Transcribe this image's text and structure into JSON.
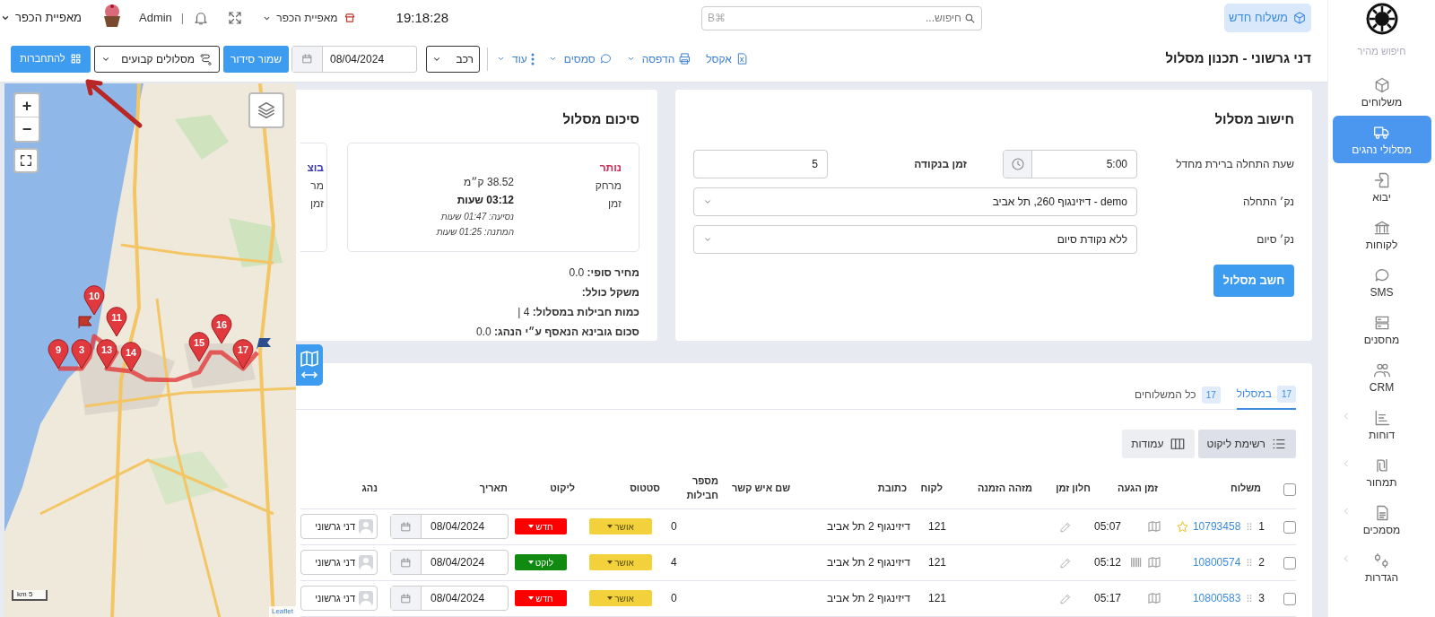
{
  "sidebar": {
    "search_label": "חיפוש מהיר",
    "items": [
      {
        "label": "משלוחים",
        "selected": false,
        "submenu": false
      },
      {
        "label": "מסלולי נהגים",
        "selected": true,
        "submenu": false
      },
      {
        "label": "יבוא",
        "selected": false,
        "submenu": false
      },
      {
        "label": "לקוחות",
        "selected": false,
        "submenu": false
      },
      {
        "label": "SMS",
        "selected": false,
        "submenu": false
      },
      {
        "label": "מחסנים",
        "selected": false,
        "submenu": false
      },
      {
        "label": "CRM",
        "selected": false,
        "submenu": false
      },
      {
        "label": "דוחות",
        "selected": false,
        "submenu": true
      },
      {
        "label": "תמחור",
        "selected": false,
        "submenu": true
      },
      {
        "label": "מסמכים",
        "selected": false,
        "submenu": true
      },
      {
        "label": "הגדרות",
        "selected": false,
        "submenu": true
      }
    ]
  },
  "header": {
    "new_button": "משלוח חדש",
    "search": {
      "placeholder": "חיפוש...",
      "shortcut": "⌘B"
    },
    "clock": "19:18:28",
    "branch": "מאפיית הכפר",
    "separator": "|",
    "user": "Admin",
    "org": "מאפיית הכפר"
  },
  "toolbar": {
    "title": "דני גרשוני - תכנון מסלול",
    "actions": [
      {
        "label": "אקסל",
        "dropdown": false
      },
      {
        "label": "הדפסה",
        "dropdown": true
      },
      {
        "label": "סמסים",
        "dropdown": true
      },
      {
        "label": "עוד",
        "dropdown": true
      }
    ],
    "vehicle": "רכב",
    "date": "08/04/2024",
    "save": "שמור סידור",
    "fixed_routes": "מסלולים קבועים",
    "connect": "להתחברות"
  },
  "route_calc": {
    "title": "חישוב מסלול",
    "start_time_label": "שעת התחלה ברירת מחדל",
    "start_time": "5:00",
    "stop_time_label": "זמן בנקודה",
    "stop_time": "5",
    "start_point_label": "נק׳ התחלה",
    "start_point": "demo - דיזינגוף 260, תל אביב",
    "end_point_label": "נק׳ סיום",
    "end_point": "ללא נקודת סיום",
    "button": "חשב מסלול"
  },
  "route_summary": {
    "title": "סיכום מסלול",
    "remaining": {
      "heading": "נותר",
      "distance_label": "מרחק",
      "distance": "38.52 ק״מ",
      "time_label": "זמן",
      "time": "03:12 שעות",
      "driving": "נסיעה: 01:47 שעות",
      "waiting": "המתנה: 01:25 שעות"
    },
    "done_card": [
      "בוצ",
      "מר",
      "זמן"
    ],
    "totals": [
      "**מחיר סופי:** 0.0",
      "**משקל כולל:**",
      "**כמות חבילות במסלול:** 4 |",
      "**סכום גובינא הנאסף ע״י הנהג:** 0.0"
    ]
  },
  "map": {
    "zoom_in": "+",
    "zoom_out": "−",
    "markers": [
      "17",
      "16",
      "15",
      "14",
      "13",
      "11",
      "10",
      "3",
      "9"
    ],
    "scale": "5 km",
    "attribution": "Leaflet"
  },
  "tabs": [
    {
      "label": "במסלול",
      "count": "17",
      "selected": true
    },
    {
      "label": "כל המשלוחים",
      "count": "17",
      "selected": false
    }
  ],
  "table_buttons": [
    "רשימת ליקוט",
    "עמודות"
  ],
  "table": {
    "select_all_checked": false,
    "columns": [
      "משלוח",
      "זמן הגעה",
      "חלון זמן",
      "מזהה הזמנה",
      "לקוח",
      "כתובת",
      "שם איש קשר",
      "מספר חבילות",
      "סטטוס",
      "ליקוט",
      "תאריך",
      "נהג"
    ],
    "rows": [
      {
        "checked": false,
        "index": "1",
        "shipment": "10793458",
        "starred": true,
        "barcode": false,
        "arrival": "05:07",
        "customer": "121",
        "address": "דיזינגוף 2 תל אביב",
        "packages": "0",
        "status": {
          "label": "אושר",
          "color": "#f2d13c"
        },
        "pick": {
          "label": "חדש",
          "color": "#ff0000"
        },
        "date": "08/04/2024",
        "driver": "דני גרשוני"
      },
      {
        "checked": false,
        "index": "2",
        "shipment": "10800574",
        "starred": false,
        "barcode": true,
        "arrival": "05:12",
        "customer": "121",
        "address": "דיזינגוף 2 תל אביב",
        "packages": "4",
        "status": {
          "label": "אושר",
          "color": "#f2d13c"
        },
        "pick": {
          "label": "לוקט",
          "color": "#108a10"
        },
        "date": "08/04/2024",
        "driver": "דני גרשוני"
      },
      {
        "checked": false,
        "index": "3",
        "shipment": "10800583",
        "starred": false,
        "barcode": false,
        "arrival": "05:17",
        "customer": "121",
        "address": "דיזינגוף 2 תל אביב",
        "packages": "0",
        "status": {
          "label": "אושר",
          "color": "#f2d13c"
        },
        "pick": {
          "label": "חדש",
          "color": "#ff0000"
        },
        "date": "08/04/2024",
        "driver": "דני גרשוני"
      }
    ]
  }
}
